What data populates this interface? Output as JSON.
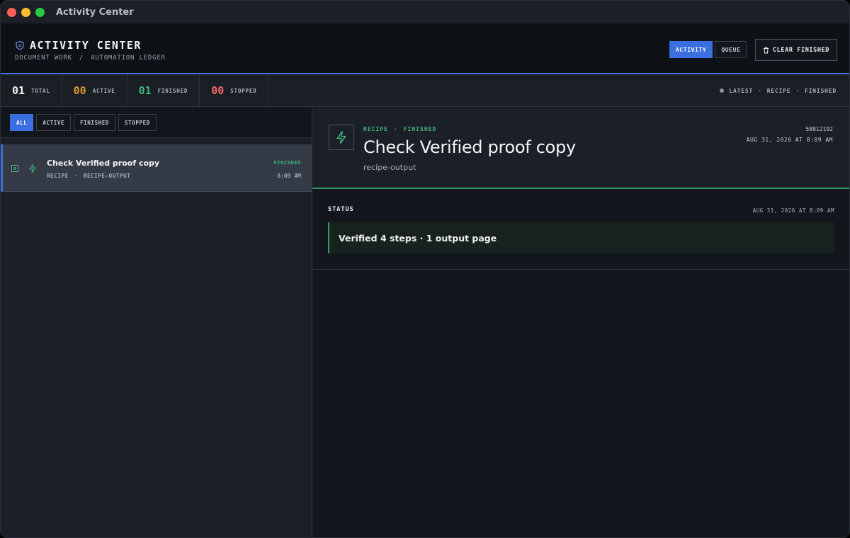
{
  "window": {
    "title": "Activity Center"
  },
  "header": {
    "title": "ACTIVITY CENTER",
    "breadcrumb": [
      "DOCUMENT WORK",
      "/",
      "AUTOMATION LEDGER"
    ],
    "view_toggle": {
      "activity": "ACTIVITY",
      "queue": "QUEUE",
      "selected": "activity"
    },
    "clear_label": "CLEAR FINISHED"
  },
  "stats": [
    {
      "value": "01",
      "label": "TOTAL",
      "color": "#f2f3f5"
    },
    {
      "value": "00",
      "label": "ACTIVE",
      "color": "#d69a2d"
    },
    {
      "value": "01",
      "label": "FINISHED",
      "color": "#3fb877"
    },
    {
      "value": "00",
      "label": "STOPPED",
      "color": "#f06a6a"
    }
  ],
  "latest": [
    "LATEST",
    "·",
    "RECIPE",
    "·",
    "FINISHED"
  ],
  "filters": {
    "all": "ALL",
    "active": "ACTIVE",
    "finished": "FINISHED",
    "stopped": "STOPPED",
    "selected": "all"
  },
  "activities": [
    {
      "title": "Check Verified proof copy",
      "meta": [
        "RECIPE",
        "·",
        "RECIPE-OUTPUT"
      ],
      "status": "FINISHED",
      "time": "8:09 AM",
      "selected": true
    }
  ],
  "detail": {
    "kicker": [
      "RECIPE",
      "·",
      "FINISHED"
    ],
    "title": "Check Verified proof copy",
    "subtitle": "recipe-output",
    "id": "58812192",
    "date": "AUG 31, 2026 AT 8:09 AM",
    "status_label": "STATUS",
    "status_date": "AUG 31, 2026 AT 8:09 AM",
    "status_message": "Verified 4 steps · 1 output page"
  },
  "colors": {
    "accent": "#3b6fe0",
    "success": "#3fb877",
    "warning": "#d69a2d",
    "danger": "#f06a6a"
  },
  "icons": {
    "app": "shield-icon",
    "activity": "bolt-icon",
    "clear": "trash-icon"
  }
}
